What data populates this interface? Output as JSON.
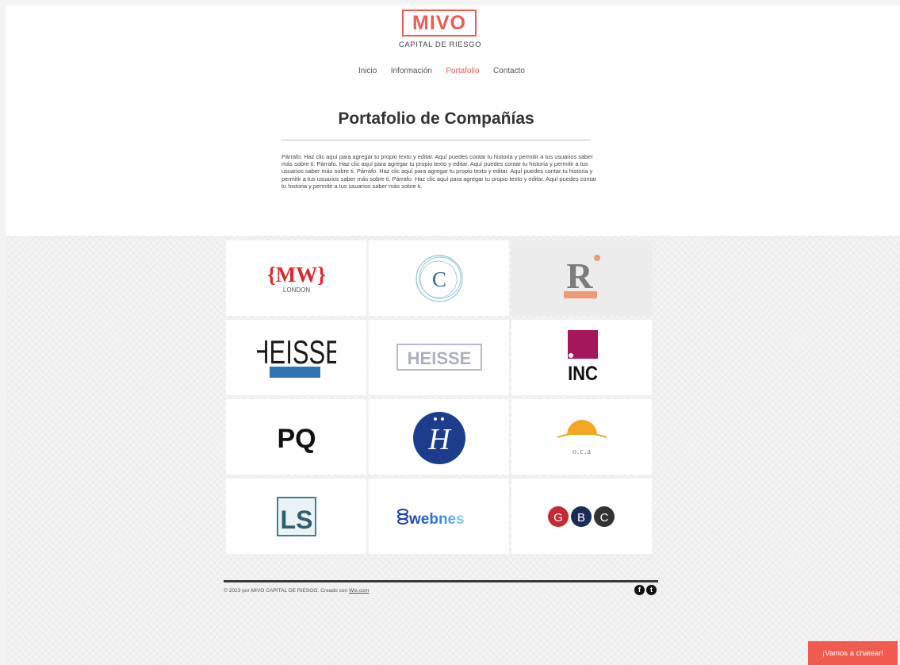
{
  "header": {
    "logo": "MIVO",
    "logo_subtitle": "CAPITAL DE RIESGO"
  },
  "nav": {
    "items": [
      {
        "label": "Inicio",
        "active": false
      },
      {
        "label": "Información",
        "active": false
      },
      {
        "label": "Portafolio",
        "active": true
      },
      {
        "label": "Contacto",
        "active": false
      }
    ]
  },
  "main": {
    "title": "Portafolio de Compañías",
    "paragraph": "Párrafo. Haz clic aquí para agregar tu propio texto y editar. Aquí puedes contar tu historia y permitir a tus usuarios saber más sobre ti. Párrafo. Haz clic aquí para agregar tu propio texto y editar. Aquí puedes contar tu historia y permitir a tus usuarios saber más sobre ti. Párrafo. Haz clic aquí para agregar tu propio texto y editar. Aquí puedes contar tu historia y permitir a tus usuarios saber más sobre ti. Párrafo. Haz clic aquí para agregar tu propio texto y editar. Aquí puedes contar tu historia y permitir a tus usuarios saber más sobre ti."
  },
  "portfolio": {
    "logos": [
      {
        "name": "mw-london-logo",
        "text": "{MW}",
        "sub": "LONDON"
      },
      {
        "name": "c-circle-logo",
        "text": "C"
      },
      {
        "name": "r-logo",
        "text": "R"
      },
      {
        "name": "heisse-black-logo",
        "text": "HEISSE"
      },
      {
        "name": "heisse-gray-logo",
        "text": "HEISSE"
      },
      {
        "name": "inc-logo",
        "text": "INC"
      },
      {
        "name": "pq-logo",
        "text": "PQ"
      },
      {
        "name": "h-script-logo",
        "text": "H"
      },
      {
        "name": "oca-logo",
        "text": "o.c.a"
      },
      {
        "name": "ls-logo",
        "text": "LS"
      },
      {
        "name": "webnes-logo",
        "text": "webnes"
      },
      {
        "name": "gbc-logo",
        "letters": [
          "G",
          "B",
          "C"
        ]
      }
    ]
  },
  "footer": {
    "copyright": "© 2023 por MIVO CAPITAL DE RIESGO. Creado con ",
    "link": "Wix.com"
  },
  "social": {
    "facebook": "f",
    "twitter": "t"
  },
  "chat": {
    "label": "¡Vamos a chatear!"
  },
  "colors": {
    "accent": "#ef5b4f",
    "text": "#333333"
  }
}
